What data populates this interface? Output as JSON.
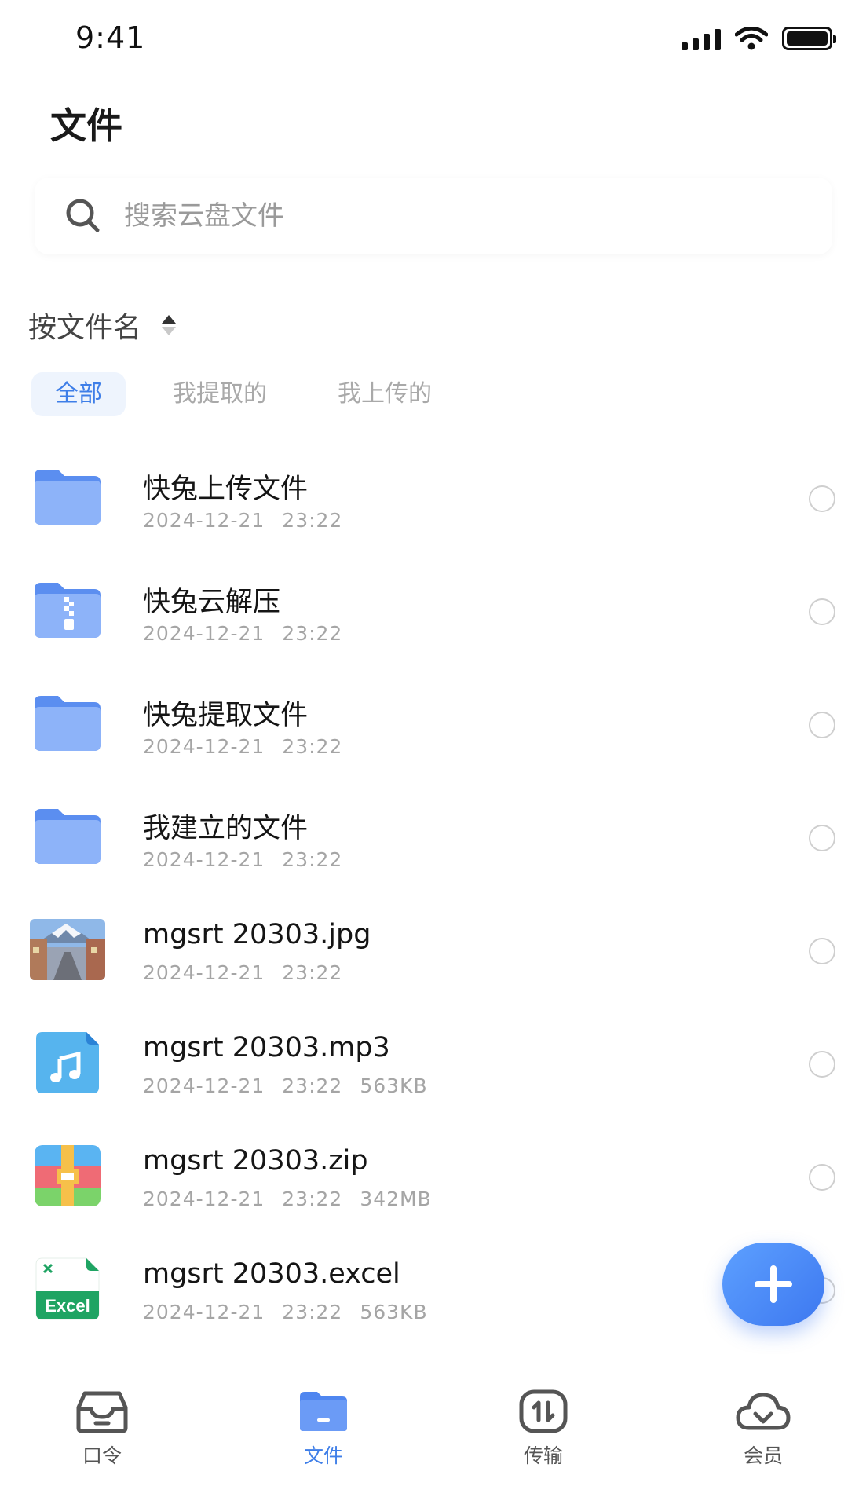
{
  "status_bar": {
    "time": "9:41"
  },
  "page_title": "文件",
  "search": {
    "placeholder": "搜索云盘文件"
  },
  "sort": {
    "label": "按文件名"
  },
  "tabs": [
    {
      "label": "全部",
      "active": true
    },
    {
      "label": "我提取的",
      "active": false
    },
    {
      "label": "我上传的",
      "active": false
    }
  ],
  "files": [
    {
      "name": "快兔上传文件",
      "date": "2024-12-21",
      "time": "23:22",
      "size": "",
      "icon": "folder-icon"
    },
    {
      "name": "快兔云解压",
      "date": "2024-12-21",
      "time": "23:22",
      "size": "",
      "icon": "zip-folder-icon"
    },
    {
      "name": "快兔提取文件",
      "date": "2024-12-21",
      "time": "23:22",
      "size": "",
      "icon": "folder-icon"
    },
    {
      "name": "我建立的文件",
      "date": "2024-12-21",
      "time": "23:22",
      "size": "",
      "icon": "folder-icon"
    },
    {
      "name": "mgsrt 20303.jpg",
      "date": "2024-12-21",
      "time": "23:22",
      "size": "",
      "icon": "image-thumbnail"
    },
    {
      "name": "mgsrt 20303.mp3",
      "date": "2024-12-21",
      "time": "23:22",
      "size": "563KB",
      "icon": "music-file-icon"
    },
    {
      "name": "mgsrt 20303.zip",
      "date": "2024-12-21",
      "time": "23:22",
      "size": "342MB",
      "icon": "zip-file-icon"
    },
    {
      "name": "mgsrt 20303.excel",
      "date": "2024-12-21",
      "time": "23:22",
      "size": "563KB",
      "icon": "excel-file-icon",
      "icon_text": "Excel"
    }
  ],
  "bottom_nav": [
    {
      "label": "口令",
      "icon": "inbox-icon",
      "active": false
    },
    {
      "label": "文件",
      "icon": "folder-icon",
      "active": true
    },
    {
      "label": "传输",
      "icon": "transfer-icon",
      "active": false
    },
    {
      "label": "会员",
      "icon": "cloud-icon",
      "active": false
    }
  ],
  "colors": {
    "accent": "#3e7ee8",
    "folder": "#7fa9f7",
    "tab_active_bg": "#eef4fd"
  }
}
